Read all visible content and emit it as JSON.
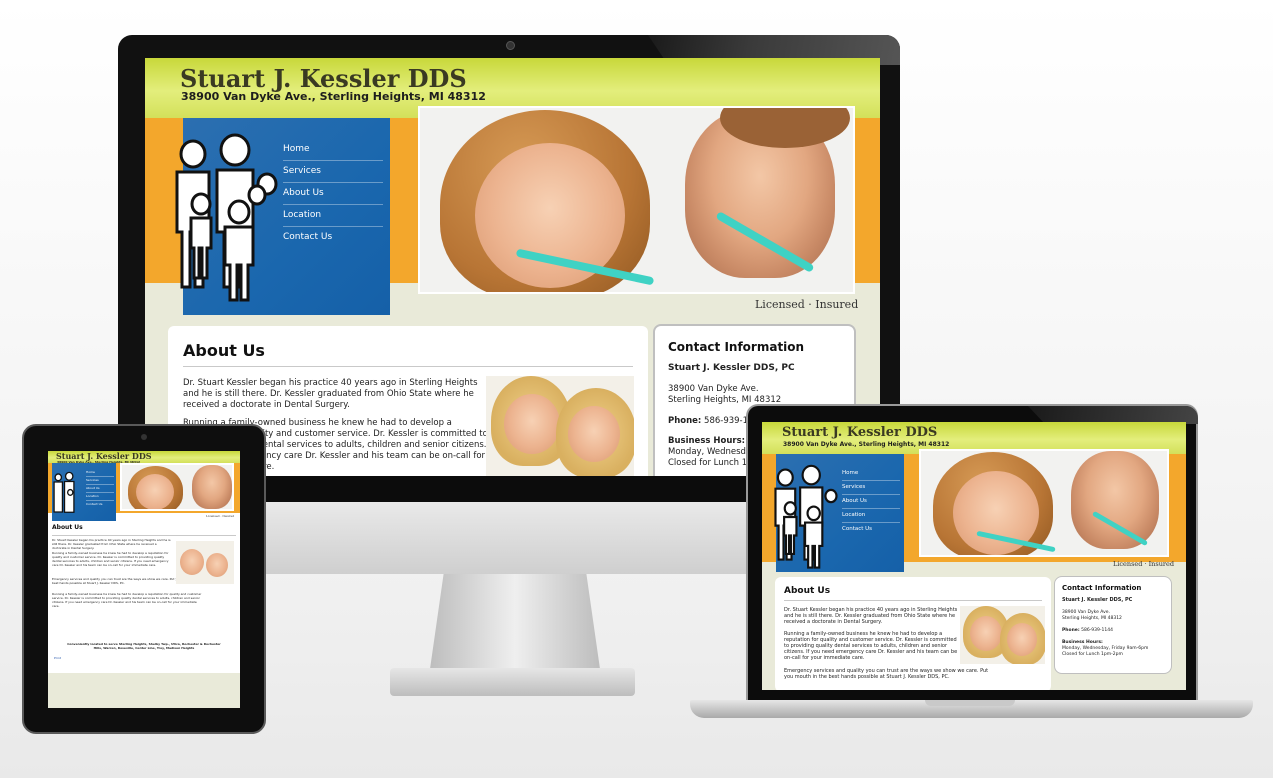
{
  "site": {
    "title": "Stuart J. Kessler DDS",
    "address": "38900 Van Dyke Ave., Sterling Heights, MI 48312",
    "nav": [
      "Home",
      "Services",
      "About Us",
      "Location",
      "Contact Us"
    ],
    "licensed": "Licensed · Insured",
    "about": {
      "heading": "About Us",
      "p1": "Dr. Stuart Kessler began his practice 40 years ago in Sterling Heights and he is still there. Dr. Kessler graduated from Ohio State where he received a doctorate in Dental Surgery.",
      "p2": "Running a family-owned business he knew he had to develop a reputation for quality and customer service. Dr. Kessler is committed to providing quality dental services to adults, children and senior citizens. If you need emergency care Dr. Kessler and his team can be on-call for your immediate care.",
      "p2_desktop_visible": "Running a family-owned business he knew he had to develop a reputation for quality and customer service. Dr. Kessler is committed to providing quality dental services to adults, children and senior citizens. If you need emergency care Dr. Kessler and his team can be on-call for your immediate care.",
      "p3": "Emergency services and quality you can trust are the ways we show we care. Put you mouth in the best hands possible at Stuart J. Kessler DDS, PC.",
      "p4": "Running a family-owned business he knew he had to develop a reputation for quality and customer service. Dr. Kessler is committed to providing quality dental services to adults, children and senior citizens. If you need emergency care Dr. Kessler and his team can be on-call for your immediate care."
    },
    "contact": {
      "heading": "Contact Information",
      "name": "Stuart J. Kessler DDS, PC",
      "street": "38900 Van Dyke Ave.",
      "city": "Sterling Heights, MI 48312",
      "phone_label": "Phone:",
      "phone": "586-939-1144",
      "hours_label": "Business Hours:",
      "hours": "Monday, Wednesday, Friday 9am-6pm",
      "lunch": "Closed for Lunch 1pm-2pm"
    },
    "footer": "Conveniently located to serve Sterling Heights, Shelby Twp., Utica, Rochester & Rochester Hills, Warren, Roseville, Center Line, Troy, Madison Heights",
    "print_link": "Print"
  },
  "colors": {
    "banner": "#d3e05a",
    "orange": "#f3a72c",
    "nav_blue": "#1a67ae",
    "page_bg": "#e9ead9",
    "teal_brush": "#3fd2c4"
  }
}
